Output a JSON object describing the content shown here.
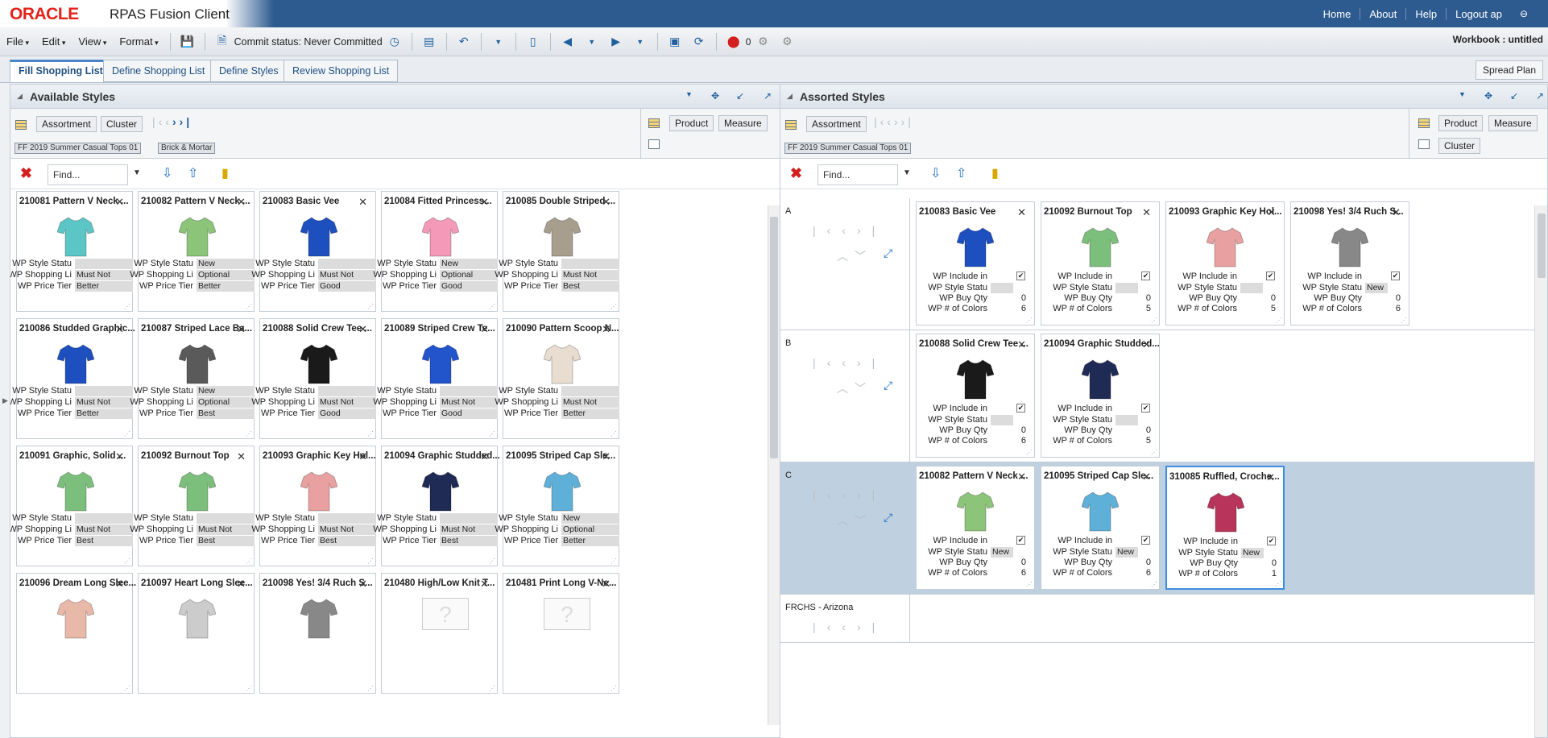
{
  "header": {
    "logo": "ORACLE",
    "app": "RPAS Fusion Client",
    "links": [
      "Home",
      "About",
      "Help",
      "Logout ap"
    ]
  },
  "menubar": {
    "menus": [
      "File",
      "Edit",
      "View",
      "Format"
    ],
    "commit": "Commit status: Never Committed",
    "errors": "0",
    "workbook": "Workbook : untitled"
  },
  "tabs": [
    "Fill Shopping List",
    "Define Shopping List",
    "Define Styles",
    "Review Shopping List"
  ],
  "spread": "Spread Plan",
  "left": {
    "title": "Available Styles",
    "assortment": "Assortment",
    "cluster": "Cluster",
    "product": "Product",
    "measure": "Measure",
    "chip1": "FF 2019 Summer Casual Tops 01",
    "chip2": "Brick & Mortar",
    "find": "Find...",
    "labels": [
      "WP Style Statu",
      "WP Shopping Li",
      "WP Price Tier"
    ],
    "cards": [
      {
        "title": "210081 Pattern V Neck ...",
        "color": "#5cc6c6",
        "v": [
          "",
          "Must Not Include",
          "Better"
        ]
      },
      {
        "title": "210082 Pattern V Neck ...",
        "color": "#8cc47a",
        "v": [
          "New",
          "Optional",
          "Better"
        ]
      },
      {
        "title": "210083 Basic Vee",
        "color": "#1e4fbf",
        "v": [
          "",
          "Must Not Include",
          "Good"
        ]
      },
      {
        "title": "210084 Fitted Princess...",
        "color": "#f49ab8",
        "v": [
          "New",
          "Optional",
          "Good"
        ]
      },
      {
        "title": "210085 Double Striped ...",
        "color": "#a79e8e",
        "v": [
          "",
          "Must Not Include",
          "Best"
        ]
      },
      {
        "title": "210086 Studded Graphic...",
        "color": "#1e4fbf",
        "v": [
          "",
          "Must Not Include",
          "Better"
        ]
      },
      {
        "title": "210087 Striped Lace Ba...",
        "color": "#5a5a5a",
        "v": [
          "New",
          "Optional",
          "Best"
        ]
      },
      {
        "title": "210088 Solid Crew Tee ...",
        "color": "#1a1a1a",
        "v": [
          "",
          "Must Not Include",
          "Good"
        ]
      },
      {
        "title": "210089 Striped Crew Te...",
        "color": "#2255cc",
        "v": [
          "",
          "Must Not Include",
          "Good"
        ]
      },
      {
        "title": "210090 Pattern Scoop N...",
        "color": "#e8ddd0",
        "v": [
          "",
          "Must Not Include",
          "Better"
        ]
      },
      {
        "title": "210091 Graphic, Solid ...",
        "color": "#7cbf7c",
        "v": [
          "",
          "Must Not Include",
          "Best"
        ]
      },
      {
        "title": "210092 Burnout Top",
        "color": "#7cbf7c",
        "v": [
          "",
          "Must Not Include",
          "Best"
        ]
      },
      {
        "title": "210093 Graphic Key Hol...",
        "color": "#e8a0a0",
        "v": [
          "",
          "Must Not Include",
          "Best"
        ]
      },
      {
        "title": "210094 Graphic Studded...",
        "color": "#1f2a55",
        "v": [
          "",
          "Must Not Include",
          "Best"
        ]
      },
      {
        "title": "210095 Striped Cap Sle...",
        "color": "#5fb0d8",
        "v": [
          "New",
          "Optional",
          "Better"
        ]
      },
      {
        "title": "210096 Dream Long Slee...",
        "color": "#e8b8a8",
        "v": [
          "",
          "",
          ""
        ]
      },
      {
        "title": "210097 Heart Long Slee...",
        "color": "#cccccc",
        "v": [
          "",
          "",
          ""
        ]
      },
      {
        "title": "210098 Yes! 3/4 Ruch S...",
        "color": "#888888",
        "v": [
          "",
          "",
          ""
        ]
      },
      {
        "title": "210480 High/Low Knit T...",
        "color": "",
        "v": [
          "",
          "",
          ""
        ]
      },
      {
        "title": "210481 Print Long V-Ne...",
        "color": "",
        "v": [
          "",
          "",
          ""
        ]
      }
    ]
  },
  "right": {
    "title": "Assorted Styles",
    "assortment": "Assortment",
    "product": "Product",
    "measure": "Measure",
    "cluster": "Cluster",
    "chip1": "FF 2019 Summer Casual Tops 01",
    "find": "Find...",
    "labels": [
      "WP Include in",
      "WP Style Statu",
      "WP Buy Qty",
      "WP # of Colors"
    ],
    "groups": [
      {
        "name": "A",
        "cards": [
          {
            "title": "210083 Basic Vee",
            "color": "#1e4fbf",
            "status": "",
            "qty": "0",
            "colors": "6"
          },
          {
            "title": "210092 Burnout Top",
            "color": "#7cbf7c",
            "status": "",
            "qty": "0",
            "colors": "5"
          },
          {
            "title": "210093 Graphic Key Hol...",
            "color": "#e8a0a0",
            "status": "",
            "qty": "0",
            "colors": "5"
          },
          {
            "title": "210098 Yes! 3/4 Ruch S...",
            "color": "#888888",
            "status": "New",
            "qty": "0",
            "colors": "6"
          }
        ]
      },
      {
        "name": "B",
        "cards": [
          {
            "title": "210088 Solid Crew Tee ...",
            "color": "#1a1a1a",
            "status": "",
            "qty": "0",
            "colors": "6"
          },
          {
            "title": "210094 Graphic Studded...",
            "color": "#1f2a55",
            "status": "",
            "qty": "0",
            "colors": "5"
          }
        ]
      },
      {
        "name": "C",
        "cards": [
          {
            "title": "210082 Pattern V Neck ...",
            "color": "#8cc47a",
            "status": "New",
            "qty": "0",
            "colors": "6"
          },
          {
            "title": "210095 Striped Cap Sle...",
            "color": "#5fb0d8",
            "status": "New",
            "qty": "0",
            "colors": "6"
          },
          {
            "title": "310085 Ruffled, Croche...",
            "color": "#b8345a",
            "status": "New",
            "qty": "0",
            "colors": "1"
          }
        ]
      },
      {
        "name": "FRCHS - Arizona",
        "cards": []
      }
    ]
  }
}
